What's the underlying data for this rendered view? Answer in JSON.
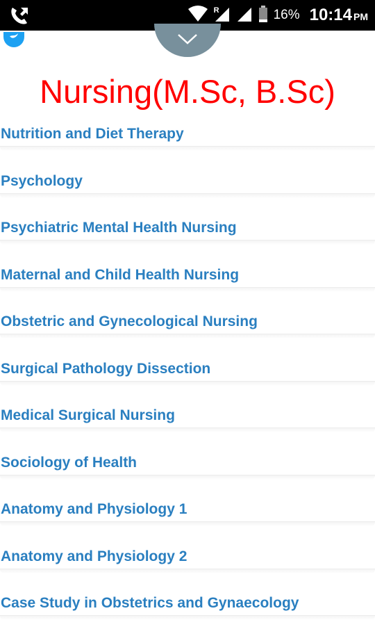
{
  "status_bar": {
    "battery_percent": "16%",
    "time": "10:14",
    "ampm": "PM",
    "network_label": "R"
  },
  "page": {
    "title": "Nursing(M.Sc, B.Sc)"
  },
  "topics": [
    "Nutrition and Diet Therapy",
    "Psychology",
    "Psychiatric Mental Health Nursing",
    "Maternal and Child Health Nursing",
    "Obstetric and Gynecological Nursing",
    "Surgical Pathology Dissection",
    "Medical Surgical Nursing",
    "Sociology of Health",
    "Anatomy and Physiology 1",
    "Anatomy and Physiology 2",
    "Case Study in Obstetrics and Gynaecology"
  ],
  "colors": {
    "title": "#ff0000",
    "link": "#2a7fc0",
    "handle": "#78909c",
    "twitter": "#1da1f2"
  }
}
